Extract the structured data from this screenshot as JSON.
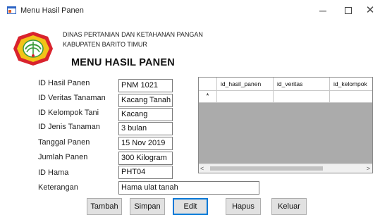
{
  "window": {
    "title": "Menu Hasil Panen",
    "minimize_glyph": "─",
    "close_glyph": "✕"
  },
  "header": {
    "agency_line1": "DINAS PERTANIAN DAN KETAHANAN PANGAN",
    "agency_line2": "KABUPATEN BARITO TIMUR",
    "menu_title": "MENU HASIL PANEN",
    "logo_icon": "emblem-icon",
    "logo_colors": {
      "outer": "#d9232d",
      "inner": "#f2c318",
      "leaf": "#3a9a3a"
    }
  },
  "form": {
    "fields": [
      {
        "label": "ID  Hasil Panen",
        "value": "PNM 1021"
      },
      {
        "label": "ID Veritas Tanaman",
        "value": "Kacang Tanah"
      },
      {
        "label": "ID Kelompok Tani",
        "value": "Kacang"
      },
      {
        "label": "ID Jenis Tanaman",
        "value": "3 bulan"
      },
      {
        "label": "Tanggal Panen",
        "value": "15 Nov 2019"
      },
      {
        "label": "Jumlah Panen",
        "value": "300 Kilogram"
      },
      {
        "label": "ID Hama",
        "value": "PHT04"
      },
      {
        "label": "Keterangan",
        "value": "Hama ulat tanah"
      }
    ]
  },
  "grid": {
    "columns": [
      "id_hasil_panen",
      "id_veritas",
      "id_kelompok"
    ],
    "new_row_marker": "*",
    "scroll_left": "<",
    "scroll_right": ">"
  },
  "buttons": {
    "tambah": "Tambah",
    "simpan": "Simpan",
    "edit": "Edit",
    "hapus": "Hapus",
    "keluar": "Keluar"
  }
}
